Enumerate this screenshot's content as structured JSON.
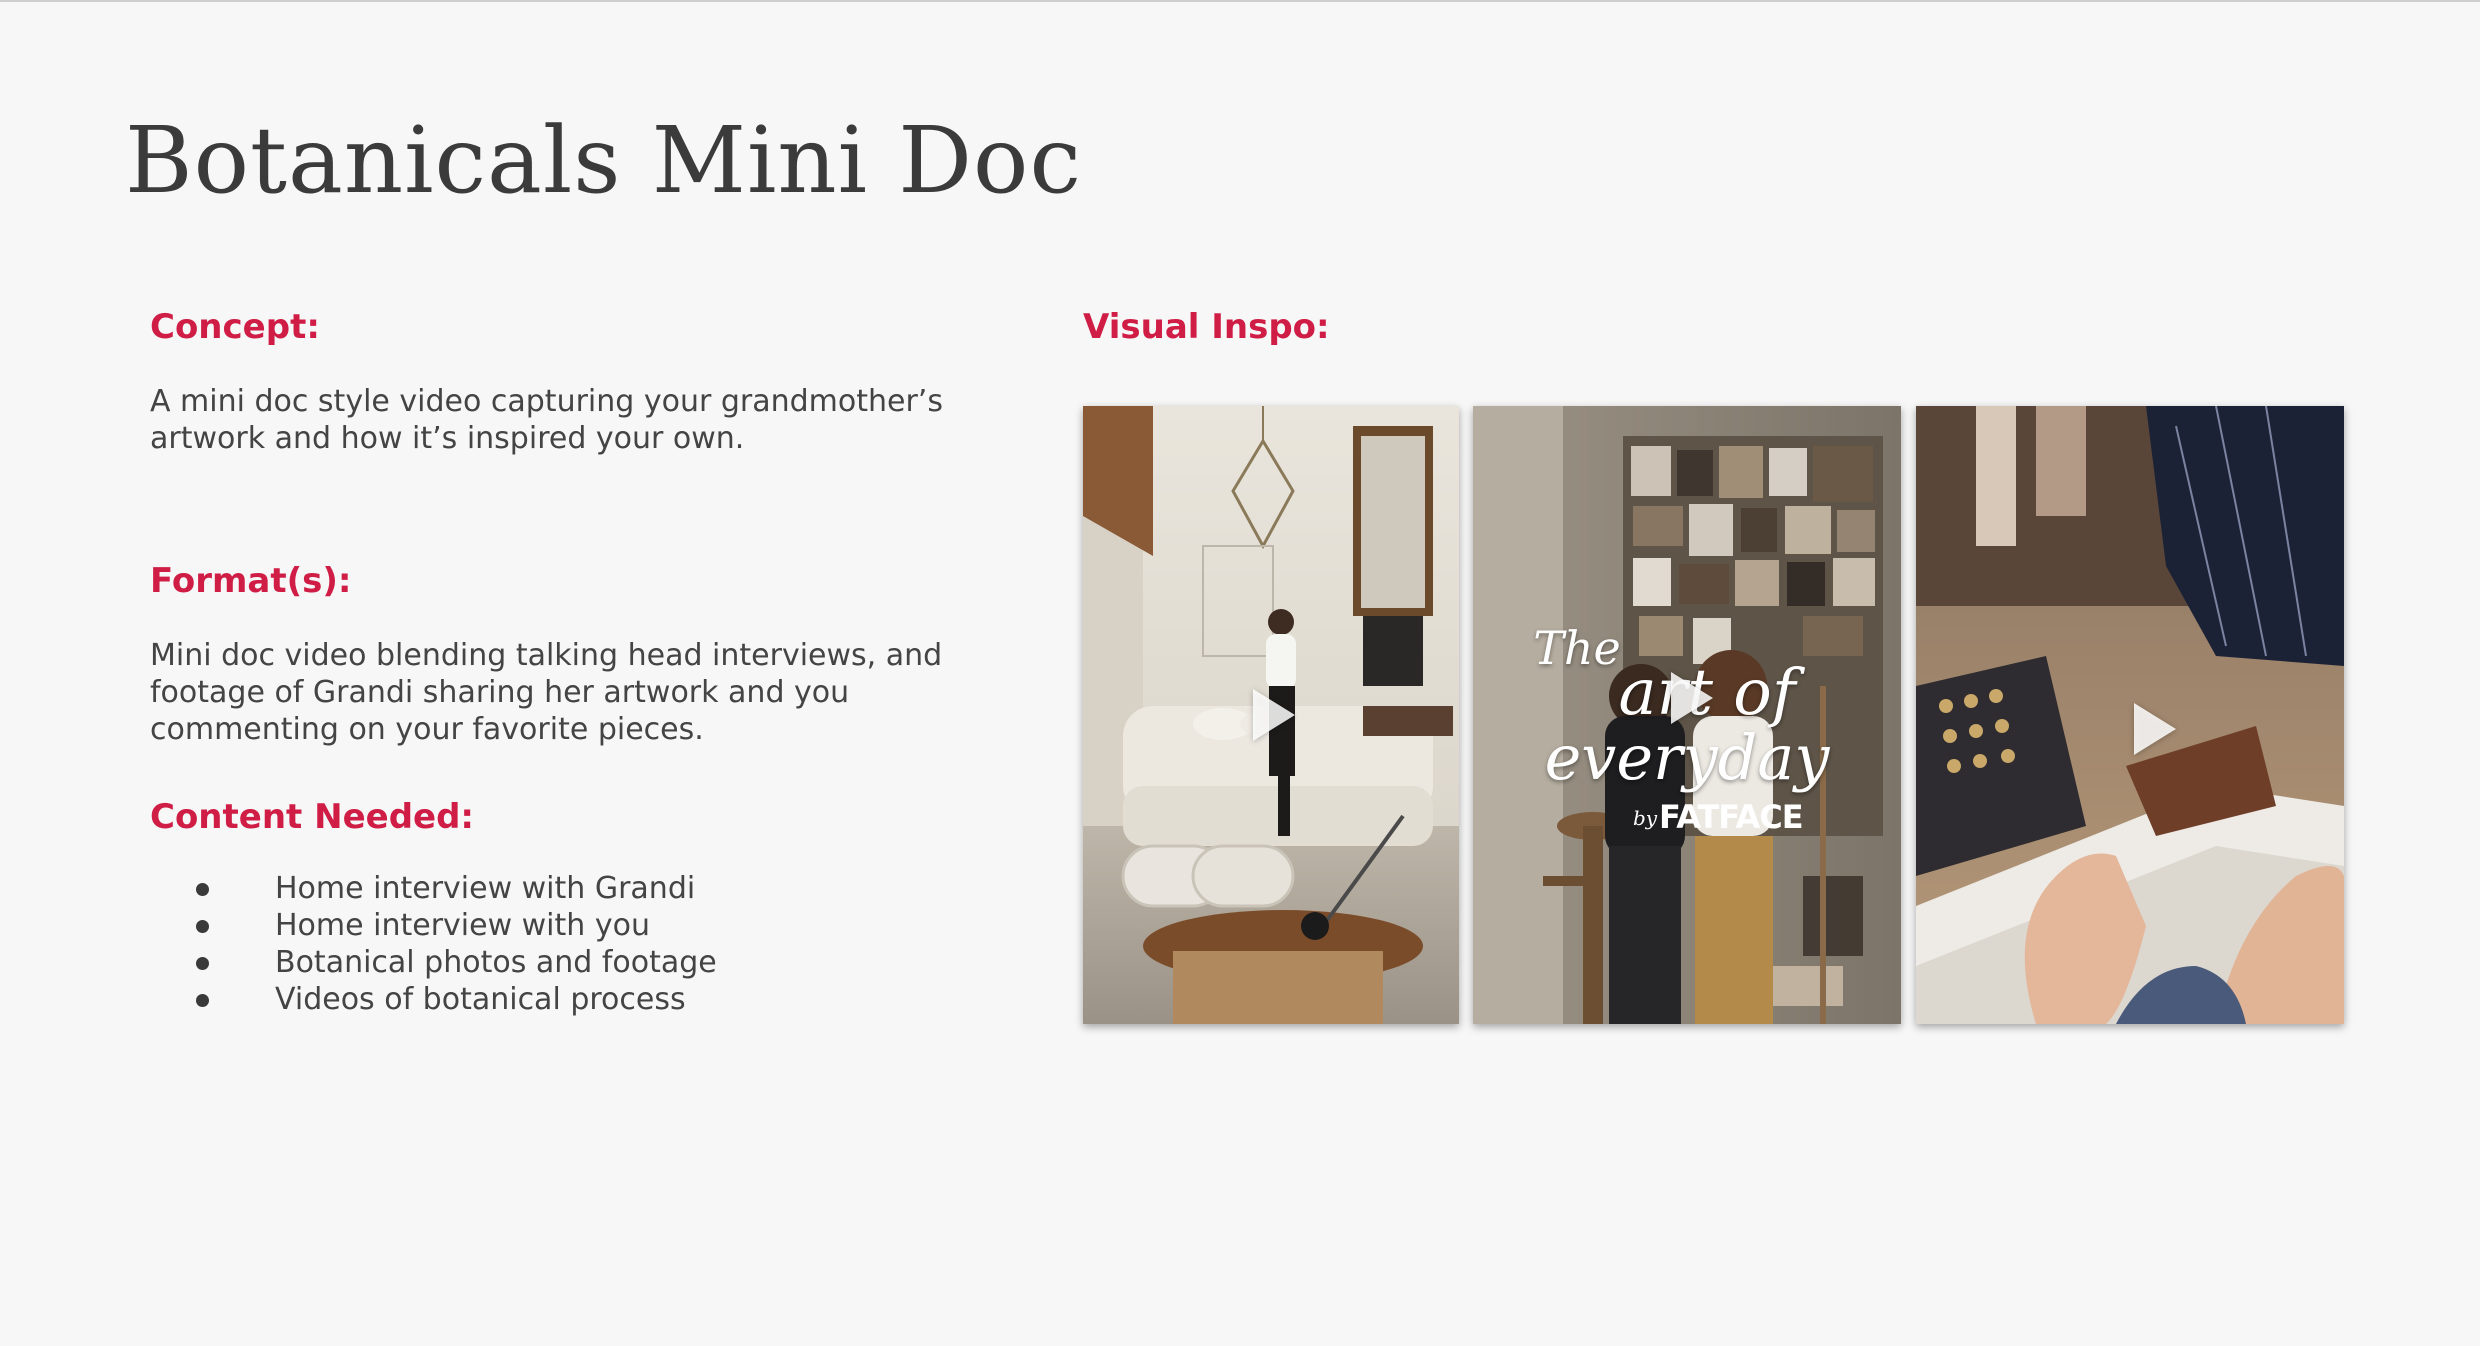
{
  "page": {
    "title": "Botanicals Mini Doc"
  },
  "concept": {
    "heading": "Concept:",
    "text": "A mini doc style video capturing your grandmother’s artwork and how it’s inspired your own."
  },
  "formats": {
    "heading": "Format(s):",
    "text": "Mini doc video blending talking head interviews, and footage of Grandi sharing her artwork and you commenting on your favorite pieces."
  },
  "content_needed": {
    "heading": "Content Needed:",
    "items": [
      "Home interview with Grandi",
      "Home interview with you",
      "Botanical photos and footage",
      "Videos of botanical process"
    ]
  },
  "visual_inspo": {
    "heading": "Visual Inspo:",
    "videos": [
      {
        "icon": "play-icon"
      },
      {
        "icon": "play-icon",
        "overlay_line1": "The",
        "overlay_line2": "art of",
        "overlay_line3": "everyday",
        "overlay_by": "by",
        "overlay_brand": "FATFACE"
      },
      {
        "icon": "play-icon"
      }
    ]
  },
  "colors": {
    "accent": "#cf1d45",
    "text": "#444444",
    "background": "#f7f7f7"
  }
}
